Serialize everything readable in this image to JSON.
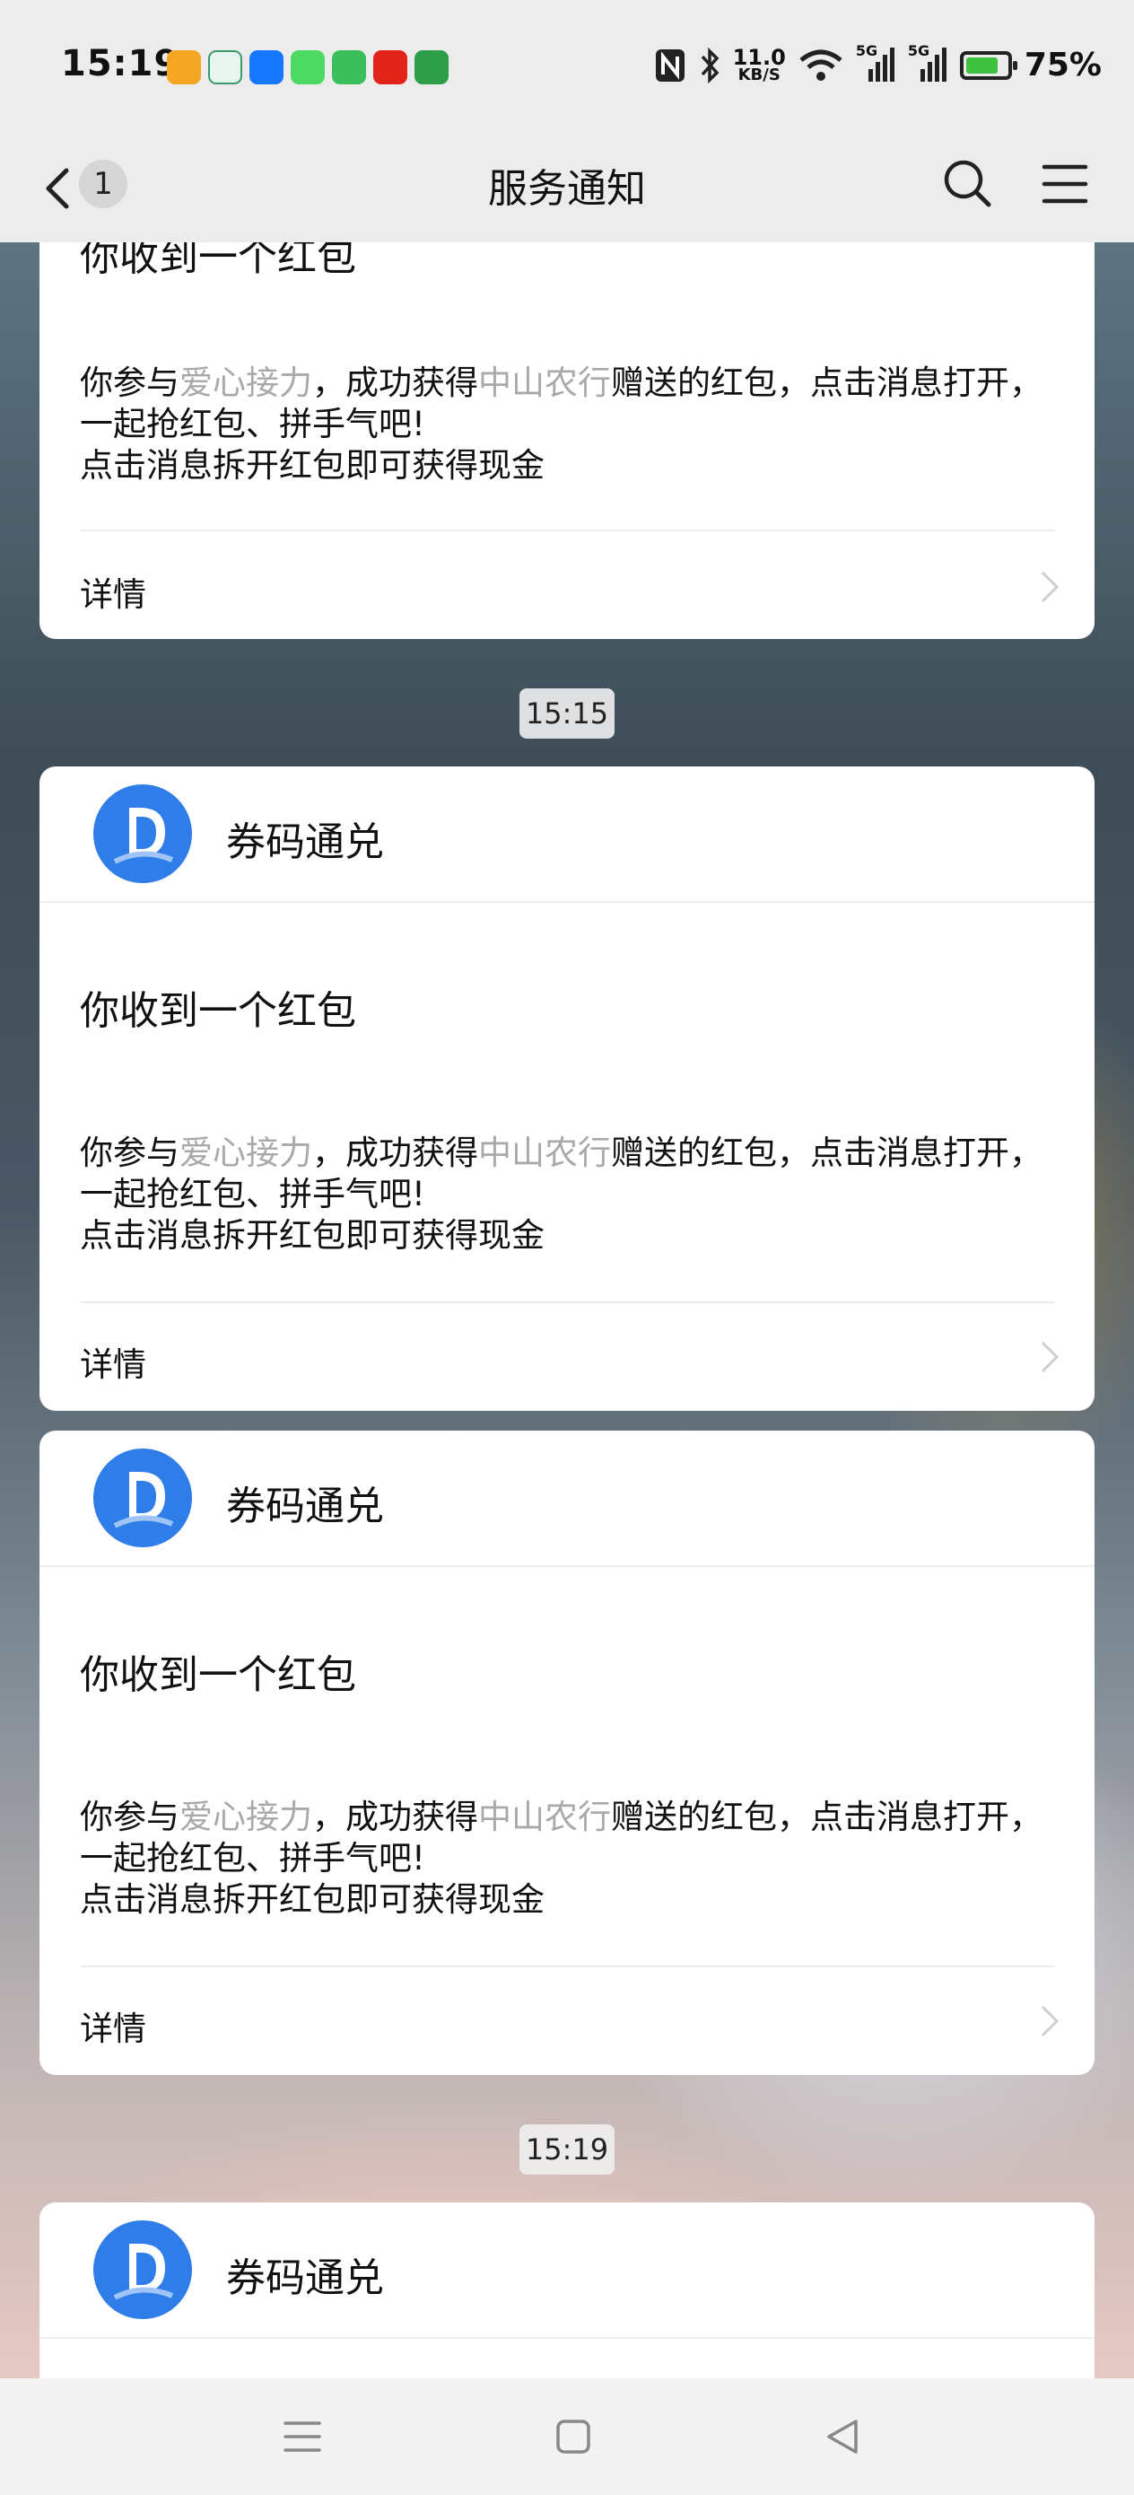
{
  "status_bar": {
    "time": "15:19",
    "net_speed_value": "11.0",
    "net_speed_unit": "KB/S",
    "network_1": "5G",
    "network_2": "5G",
    "battery": "75%",
    "notification_icons": [
      "mail-icon",
      "bank-icon",
      "alipay-icon",
      "messages-icon",
      "app-store-icon",
      "suning-icon",
      "oppo-icon"
    ]
  },
  "nav": {
    "title": "服务通知",
    "unread_count": "1"
  },
  "messages": [
    {
      "title": "你收到一个红包",
      "body_pre": "你参与",
      "body_hl1": "爱心接力",
      "body_mid": "，成功获得",
      "body_hl2": "中山农行",
      "body_post": "赠送的红包，点击消息打开，一起抢红包、拼手气吧!",
      "body_line2": "点击消息拆开红包即可获得现金",
      "details": "详情"
    },
    {
      "timestamp": "15:15",
      "app_name": "券码通兑",
      "title": "你收到一个红包",
      "body_pre": "你参与",
      "body_hl1": "爱心接力",
      "body_mid": "，成功获得",
      "body_hl2": "中山农行",
      "body_post": "赠送的红包，点击消息打开，一起抢红包、拼手气吧!",
      "body_line2": "点击消息拆开红包即可获得现金",
      "details": "详情"
    },
    {
      "app_name": "券码通兑",
      "title": "你收到一个红包",
      "body_pre": "你参与",
      "body_hl1": "爱心接力",
      "body_mid": "，成功获得",
      "body_hl2": "中山农行",
      "body_post": "赠送的红包，点击消息打开，一起抢红包、拼手气吧!",
      "body_line2": "点击消息拆开红包即可获得现金",
      "details": "详情"
    },
    {
      "timestamp": "15:19",
      "app_name": "券码通兑"
    }
  ],
  "colors": {
    "highlight_text": "#a9a9a9",
    "logo_blue": "#2f7de8",
    "battery_green": "#3fc23f"
  }
}
